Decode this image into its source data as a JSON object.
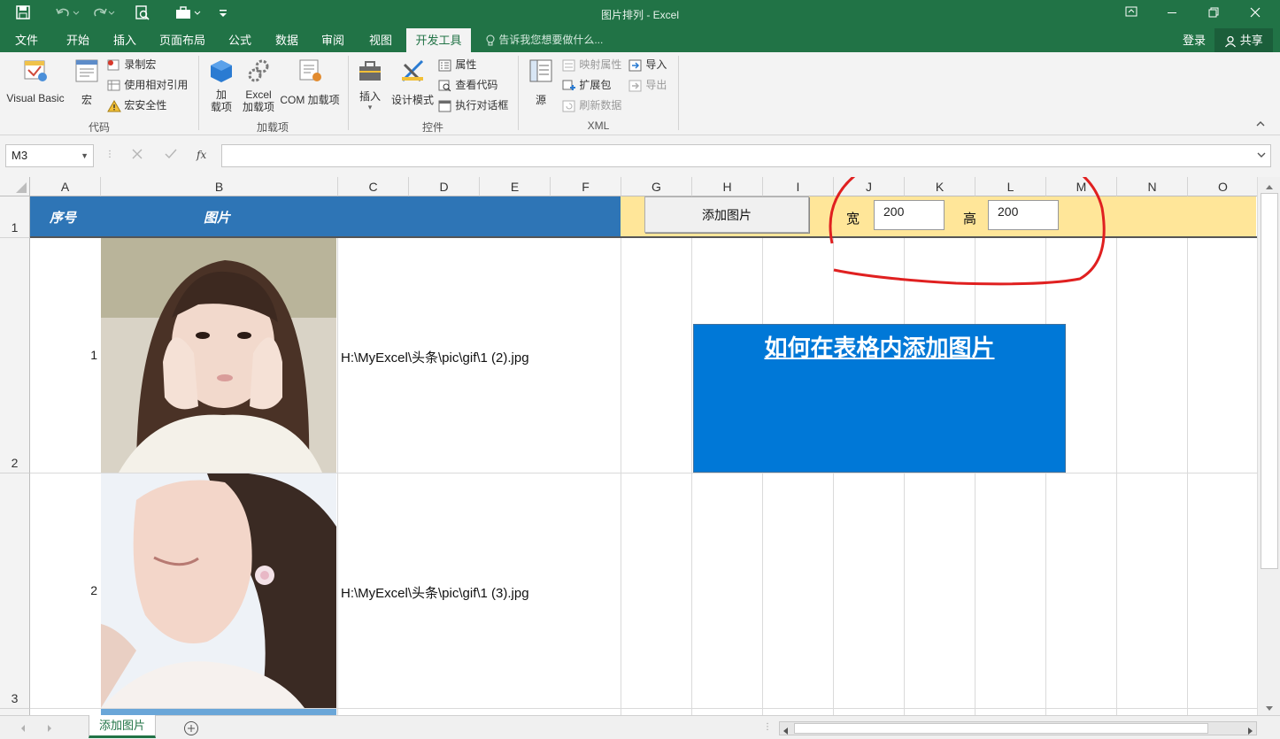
{
  "app": {
    "title": "图片排列 - Excel"
  },
  "tabs": [
    "文件",
    "开始",
    "插入",
    "页面布局",
    "公式",
    "数据",
    "审阅",
    "视图",
    "开发工具"
  ],
  "tell_me": "告诉我您想要做什么...",
  "login": "登录",
  "share": "共享",
  "ribbon": {
    "code": {
      "label": "代码",
      "visual_basic": "Visual Basic",
      "macro": "宏",
      "record": "录制宏",
      "relative": "使用相对引用",
      "security": "宏安全性"
    },
    "addins": {
      "label": "加载项",
      "addin_1": "加",
      "addin_2": "载项",
      "excel_1": "Excel",
      "excel_2": "加载项",
      "com": "COM 加载项"
    },
    "controls": {
      "label": "控件",
      "insert": "插入",
      "design": "设计模式",
      "properties": "属性",
      "view_code": "查看代码",
      "run_dialog": "执行对话框"
    },
    "xml": {
      "label": "XML",
      "source": "源",
      "map_props": "映射属性",
      "expansion": "扩展包",
      "refresh": "刷新数据",
      "import": "导入",
      "export": "导出"
    }
  },
  "formula_bar": {
    "name_box": "M3",
    "fx": "fx",
    "formula": ""
  },
  "columns": [
    "A",
    "B",
    "C",
    "D",
    "E",
    "F",
    "G",
    "H",
    "I",
    "J",
    "K",
    "L",
    "M",
    "N",
    "O"
  ],
  "rows": [
    "1",
    "2",
    "3"
  ],
  "header_row": {
    "col_a": "序号",
    "col_b": "图片",
    "add_button": "添加图片",
    "width_label": "宽",
    "width_value": "200",
    "height_label": "高",
    "height_value": "200"
  },
  "data_rows": [
    {
      "index": "1",
      "path": "H:\\MyExcel\\头条\\pic\\gif\\1 (2).jpg"
    },
    {
      "index": "2",
      "path": "H:\\MyExcel\\头条\\pic\\gif\\1 (3).jpg"
    }
  ],
  "shape": {
    "text": "如何在表格内添加图片"
  },
  "sheet_tab": "添加图片",
  "colors": {
    "excel_green": "#217346",
    "header_blue": "#2e75b6",
    "header_yellow": "#ffe699",
    "shape_blue": "#0078d7",
    "annotation_red": "#e02020"
  }
}
